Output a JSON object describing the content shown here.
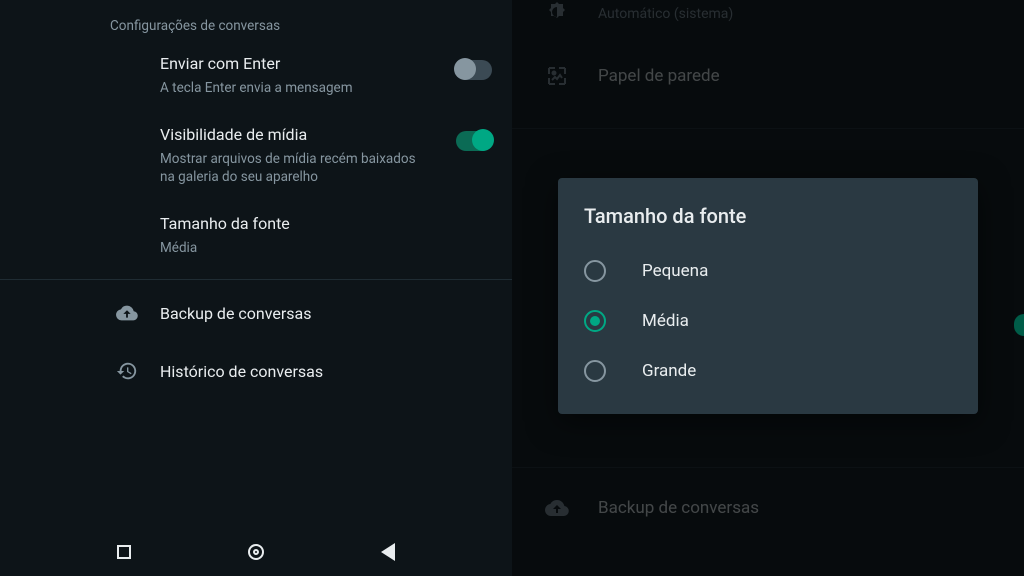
{
  "left": {
    "section_header": "Configurações de conversas",
    "enter_send": {
      "title": "Enviar com Enter",
      "subtitle": "A tecla Enter envia a mensagem",
      "on": false
    },
    "media_vis": {
      "title": "Visibilidade de mídia",
      "subtitle": "Mostrar arquivos de mídia recém baixados na galeria do seu aparelho",
      "on": true
    },
    "font_size": {
      "title": "Tamanho da fonte",
      "subtitle": "Média"
    },
    "backup": "Backup de conversas",
    "history": "Histórico de conversas"
  },
  "right": {
    "theme_sub": "Automático (sistema)",
    "wallpaper": "Papel de parede",
    "backup": "Backup de conversas"
  },
  "dialog": {
    "title": "Tamanho da fonte",
    "options": {
      "small": "Pequena",
      "medium": "Média",
      "large": "Grande"
    },
    "selected": "medium"
  }
}
